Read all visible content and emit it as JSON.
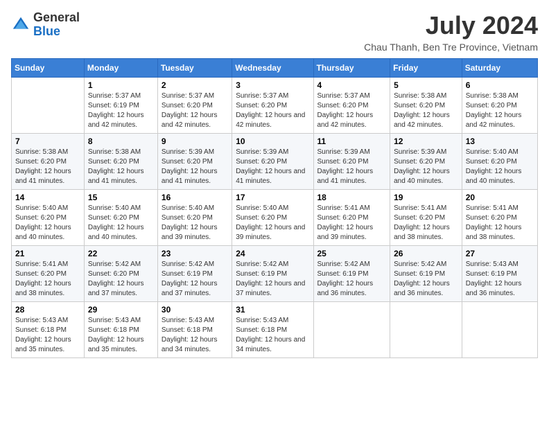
{
  "logo": {
    "general": "General",
    "blue": "Blue"
  },
  "header": {
    "month_year": "July 2024",
    "location": "Chau Thanh, Ben Tre Province, Vietnam"
  },
  "days_of_week": [
    "Sunday",
    "Monday",
    "Tuesday",
    "Wednesday",
    "Thursday",
    "Friday",
    "Saturday"
  ],
  "weeks": [
    [
      {
        "day": null,
        "sunrise": null,
        "sunset": null,
        "daylight": null
      },
      {
        "day": "1",
        "sunrise": "Sunrise: 5:37 AM",
        "sunset": "Sunset: 6:19 PM",
        "daylight": "Daylight: 12 hours and 42 minutes."
      },
      {
        "day": "2",
        "sunrise": "Sunrise: 5:37 AM",
        "sunset": "Sunset: 6:20 PM",
        "daylight": "Daylight: 12 hours and 42 minutes."
      },
      {
        "day": "3",
        "sunrise": "Sunrise: 5:37 AM",
        "sunset": "Sunset: 6:20 PM",
        "daylight": "Daylight: 12 hours and 42 minutes."
      },
      {
        "day": "4",
        "sunrise": "Sunrise: 5:37 AM",
        "sunset": "Sunset: 6:20 PM",
        "daylight": "Daylight: 12 hours and 42 minutes."
      },
      {
        "day": "5",
        "sunrise": "Sunrise: 5:38 AM",
        "sunset": "Sunset: 6:20 PM",
        "daylight": "Daylight: 12 hours and 42 minutes."
      },
      {
        "day": "6",
        "sunrise": "Sunrise: 5:38 AM",
        "sunset": "Sunset: 6:20 PM",
        "daylight": "Daylight: 12 hours and 42 minutes."
      }
    ],
    [
      {
        "day": "7",
        "sunrise": "Sunrise: 5:38 AM",
        "sunset": "Sunset: 6:20 PM",
        "daylight": "Daylight: 12 hours and 41 minutes."
      },
      {
        "day": "8",
        "sunrise": "Sunrise: 5:38 AM",
        "sunset": "Sunset: 6:20 PM",
        "daylight": "Daylight: 12 hours and 41 minutes."
      },
      {
        "day": "9",
        "sunrise": "Sunrise: 5:39 AM",
        "sunset": "Sunset: 6:20 PM",
        "daylight": "Daylight: 12 hours and 41 minutes."
      },
      {
        "day": "10",
        "sunrise": "Sunrise: 5:39 AM",
        "sunset": "Sunset: 6:20 PM",
        "daylight": "Daylight: 12 hours and 41 minutes."
      },
      {
        "day": "11",
        "sunrise": "Sunrise: 5:39 AM",
        "sunset": "Sunset: 6:20 PM",
        "daylight": "Daylight: 12 hours and 41 minutes."
      },
      {
        "day": "12",
        "sunrise": "Sunrise: 5:39 AM",
        "sunset": "Sunset: 6:20 PM",
        "daylight": "Daylight: 12 hours and 40 minutes."
      },
      {
        "day": "13",
        "sunrise": "Sunrise: 5:40 AM",
        "sunset": "Sunset: 6:20 PM",
        "daylight": "Daylight: 12 hours and 40 minutes."
      }
    ],
    [
      {
        "day": "14",
        "sunrise": "Sunrise: 5:40 AM",
        "sunset": "Sunset: 6:20 PM",
        "daylight": "Daylight: 12 hours and 40 minutes."
      },
      {
        "day": "15",
        "sunrise": "Sunrise: 5:40 AM",
        "sunset": "Sunset: 6:20 PM",
        "daylight": "Daylight: 12 hours and 40 minutes."
      },
      {
        "day": "16",
        "sunrise": "Sunrise: 5:40 AM",
        "sunset": "Sunset: 6:20 PM",
        "daylight": "Daylight: 12 hours and 39 minutes."
      },
      {
        "day": "17",
        "sunrise": "Sunrise: 5:40 AM",
        "sunset": "Sunset: 6:20 PM",
        "daylight": "Daylight: 12 hours and 39 minutes."
      },
      {
        "day": "18",
        "sunrise": "Sunrise: 5:41 AM",
        "sunset": "Sunset: 6:20 PM",
        "daylight": "Daylight: 12 hours and 39 minutes."
      },
      {
        "day": "19",
        "sunrise": "Sunrise: 5:41 AM",
        "sunset": "Sunset: 6:20 PM",
        "daylight": "Daylight: 12 hours and 38 minutes."
      },
      {
        "day": "20",
        "sunrise": "Sunrise: 5:41 AM",
        "sunset": "Sunset: 6:20 PM",
        "daylight": "Daylight: 12 hours and 38 minutes."
      }
    ],
    [
      {
        "day": "21",
        "sunrise": "Sunrise: 5:41 AM",
        "sunset": "Sunset: 6:20 PM",
        "daylight": "Daylight: 12 hours and 38 minutes."
      },
      {
        "day": "22",
        "sunrise": "Sunrise: 5:42 AM",
        "sunset": "Sunset: 6:20 PM",
        "daylight": "Daylight: 12 hours and 37 minutes."
      },
      {
        "day": "23",
        "sunrise": "Sunrise: 5:42 AM",
        "sunset": "Sunset: 6:19 PM",
        "daylight": "Daylight: 12 hours and 37 minutes."
      },
      {
        "day": "24",
        "sunrise": "Sunrise: 5:42 AM",
        "sunset": "Sunset: 6:19 PM",
        "daylight": "Daylight: 12 hours and 37 minutes."
      },
      {
        "day": "25",
        "sunrise": "Sunrise: 5:42 AM",
        "sunset": "Sunset: 6:19 PM",
        "daylight": "Daylight: 12 hours and 36 minutes."
      },
      {
        "day": "26",
        "sunrise": "Sunrise: 5:42 AM",
        "sunset": "Sunset: 6:19 PM",
        "daylight": "Daylight: 12 hours and 36 minutes."
      },
      {
        "day": "27",
        "sunrise": "Sunrise: 5:43 AM",
        "sunset": "Sunset: 6:19 PM",
        "daylight": "Daylight: 12 hours and 36 minutes."
      }
    ],
    [
      {
        "day": "28",
        "sunrise": "Sunrise: 5:43 AM",
        "sunset": "Sunset: 6:18 PM",
        "daylight": "Daylight: 12 hours and 35 minutes."
      },
      {
        "day": "29",
        "sunrise": "Sunrise: 5:43 AM",
        "sunset": "Sunset: 6:18 PM",
        "daylight": "Daylight: 12 hours and 35 minutes."
      },
      {
        "day": "30",
        "sunrise": "Sunrise: 5:43 AM",
        "sunset": "Sunset: 6:18 PM",
        "daylight": "Daylight: 12 hours and 34 minutes."
      },
      {
        "day": "31",
        "sunrise": "Sunrise: 5:43 AM",
        "sunset": "Sunset: 6:18 PM",
        "daylight": "Daylight: 12 hours and 34 minutes."
      },
      {
        "day": null,
        "sunrise": null,
        "sunset": null,
        "daylight": null
      },
      {
        "day": null,
        "sunrise": null,
        "sunset": null,
        "daylight": null
      },
      {
        "day": null,
        "sunrise": null,
        "sunset": null,
        "daylight": null
      }
    ]
  ]
}
